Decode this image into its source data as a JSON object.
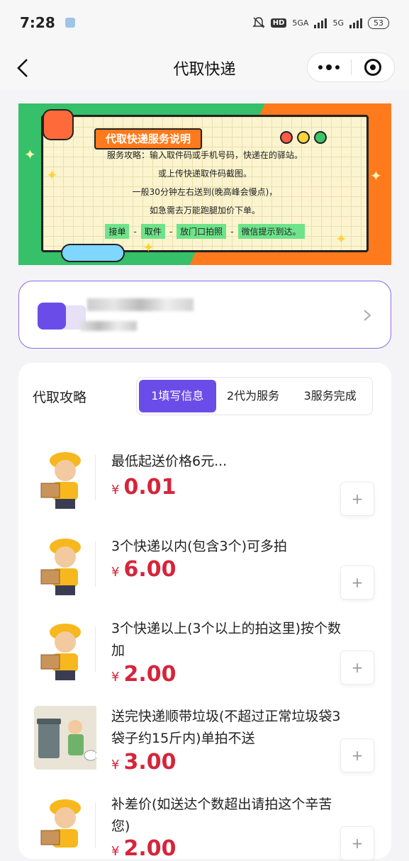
{
  "status_bar": {
    "time": "7:28",
    "indicators": [
      "HD",
      "5GA",
      "5G"
    ],
    "battery": "53"
  },
  "nav": {
    "title": "代取快递",
    "back_icon": "chevron-left-icon",
    "more_icon": "more-dots-icon",
    "close_icon": "target-icon"
  },
  "banner": {
    "title": "代取快递服务说明",
    "lines": [
      "服务攻略：输入取件码或手机号码，快递在的驿站。",
      "或上传快递取件码截图。",
      "一般30分钟左右送到(晚高峰会慢点)，",
      "如急需去万能跑腿加价下单。"
    ],
    "steps": [
      "接单",
      "取件",
      "放门口拍照",
      "微信提示到达。"
    ],
    "step_sep": "-"
  },
  "user_card": {
    "chevron_icon": "chevron-right-icon"
  },
  "guide": {
    "title": "代取攻略",
    "tabs": [
      "1填写信息",
      "2代为服务",
      "3服务完成"
    ]
  },
  "products": [
    {
      "name": "最低起送价格6元...",
      "currency": "¥",
      "price": "0.01",
      "image": "courier-boy-image"
    },
    {
      "name": "3个快递以内(包含3个)可多拍",
      "currency": "¥",
      "price": "6.00",
      "image": "courier-boy-image"
    },
    {
      "name": "3个快递以上(3个以上的拍这里)按个数加",
      "currency": "¥",
      "price": "2.00",
      "image": "courier-boy-image"
    },
    {
      "name": "送完快递顺带垃圾(不超过正常垃圾袋3袋子约15斤内)单拍不送",
      "currency": "¥",
      "price": "3.00",
      "image": "trash-bin-image"
    },
    {
      "name": "补差价(如送达个数超出请拍这个辛苦您)",
      "currency": "¥",
      "price": "2.00",
      "image": "courier-boy-image"
    }
  ],
  "add_label": "+",
  "colors": {
    "accent": "#6a4de8",
    "price": "#d5253a",
    "banner_green": "#36c06a",
    "banner_orange": "#ff7a1c"
  }
}
